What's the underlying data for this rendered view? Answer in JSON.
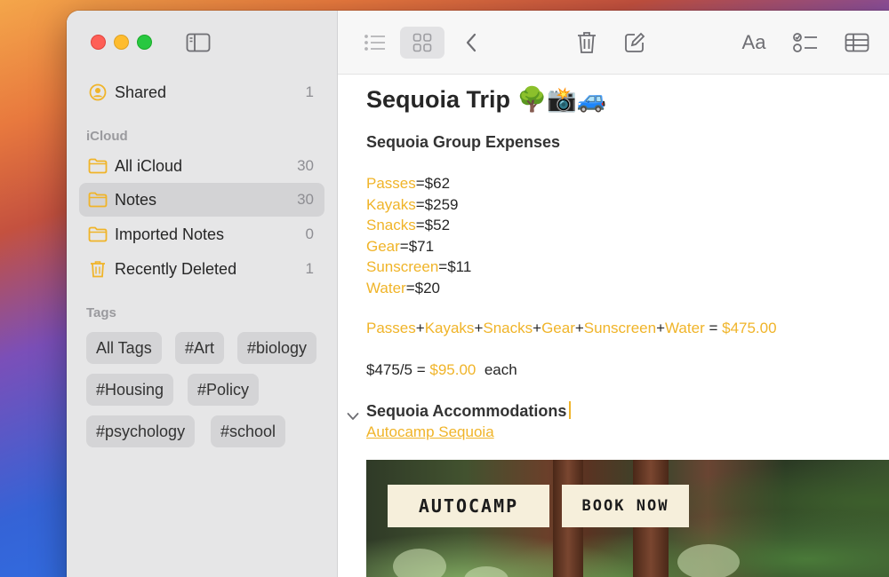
{
  "sidebar": {
    "shared": {
      "label": "Shared",
      "count": "1"
    },
    "icloud_header": "iCloud",
    "folders": [
      {
        "label": "All iCloud",
        "count": "30"
      },
      {
        "label": "Notes",
        "count": "30"
      },
      {
        "label": "Imported Notes",
        "count": "0"
      },
      {
        "label": "Recently Deleted",
        "count": "1"
      }
    ],
    "tags_header": "Tags",
    "tags": [
      "All Tags",
      "#Art",
      "#biology",
      "#Housing",
      "#Policy",
      "#psychology",
      "#school"
    ]
  },
  "toolbar": {
    "icons": [
      "list-view-icon",
      "gallery-view-icon",
      "back-icon",
      "trash-icon",
      "compose-icon",
      "format-text-icon",
      "checklist-icon",
      "table-icon"
    ],
    "format_label": "Aa"
  },
  "note": {
    "title": "Sequoia Trip 🌳📸🚙",
    "expenses_heading": "Sequoia Group Expenses",
    "expenses": [
      {
        "name": "Passes",
        "value": "=$62"
      },
      {
        "name": "Kayaks",
        "value": "=$259"
      },
      {
        "name": "Snacks",
        "value": "=$52"
      },
      {
        "name": "Gear",
        "value": "=$71"
      },
      {
        "name": "Sunscreen",
        "value": "=$11"
      },
      {
        "name": "Water",
        "value": "=$20"
      }
    ],
    "sum_terms": [
      "Passes",
      "Kayaks",
      "Snacks",
      "Gear",
      "Sunscreen",
      "Water"
    ],
    "sum_total": "$475.00",
    "division_expr": "$475/5",
    "division_result": "$95.00",
    "division_suffix": "each",
    "accommodations_heading": "Sequoia Accommodations",
    "link_text": "Autocamp Sequoia",
    "preview": {
      "brand": "AUTOCAMP",
      "cta": "BOOK NOW"
    }
  },
  "colors": {
    "accent": "#f0b429",
    "sidebar_bg": "#e6e6e7",
    "selected_row": "#d3d3d5"
  }
}
